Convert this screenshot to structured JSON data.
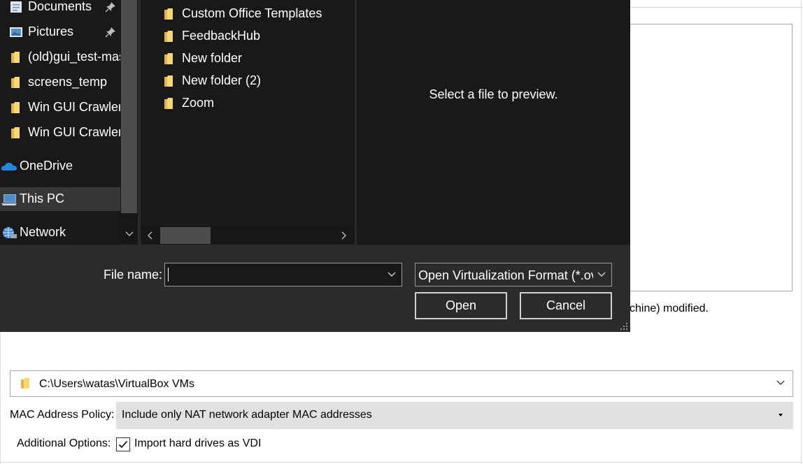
{
  "dialog": {
    "nav_items": [
      {
        "label": "Documents",
        "icon": "documents-icon",
        "pinned": true
      },
      {
        "label": "Pictures",
        "icon": "pictures-icon",
        "pinned": true
      },
      {
        "label": "(old)gui_test-mas",
        "icon": "folder-icon",
        "pinned": false
      },
      {
        "label": "screens_temp",
        "icon": "folder-icon",
        "pinned": false
      },
      {
        "label": "Win GUI Crawler",
        "icon": "folder-icon",
        "pinned": false
      },
      {
        "label": "Win GUI Crawler",
        "icon": "folder-icon",
        "pinned": false
      },
      {
        "label": "OneDrive",
        "icon": "onedrive-icon",
        "pinned": false
      },
      {
        "label": "This PC",
        "icon": "this-pc-icon",
        "pinned": false,
        "selected": true
      },
      {
        "label": "Network",
        "icon": "network-icon",
        "pinned": false
      }
    ],
    "files": [
      {
        "label": "Custom Office Templates"
      },
      {
        "label": "FeedbackHub"
      },
      {
        "label": "New folder"
      },
      {
        "label": "New folder (2)"
      },
      {
        "label": "Zoom"
      }
    ],
    "preview_text": "Select a file to preview.",
    "file_name_label": "File name:",
    "file_name_value": "",
    "filter_value": "Open Virtualization Format (*.ova)",
    "open_label": "Open",
    "cancel_label": "Cancel"
  },
  "wizard": {
    "note_text": "chine) modified.",
    "machine_folder": "C:\\Users\\watas\\VirtualBox VMs",
    "mac_policy_label": "MAC Address Policy:",
    "mac_policy_value": "Include only NAT network adapter MAC addresses",
    "additional_options_label": "Additional Options:",
    "import_vdi_label": "Import hard drives as VDI",
    "import_vdi_checked": true
  },
  "colors": {
    "dialog_bg": "#2b2b2b",
    "pane_bg": "#191919",
    "folder_yellow": "#f8d775",
    "selected_bg": "#373737"
  }
}
